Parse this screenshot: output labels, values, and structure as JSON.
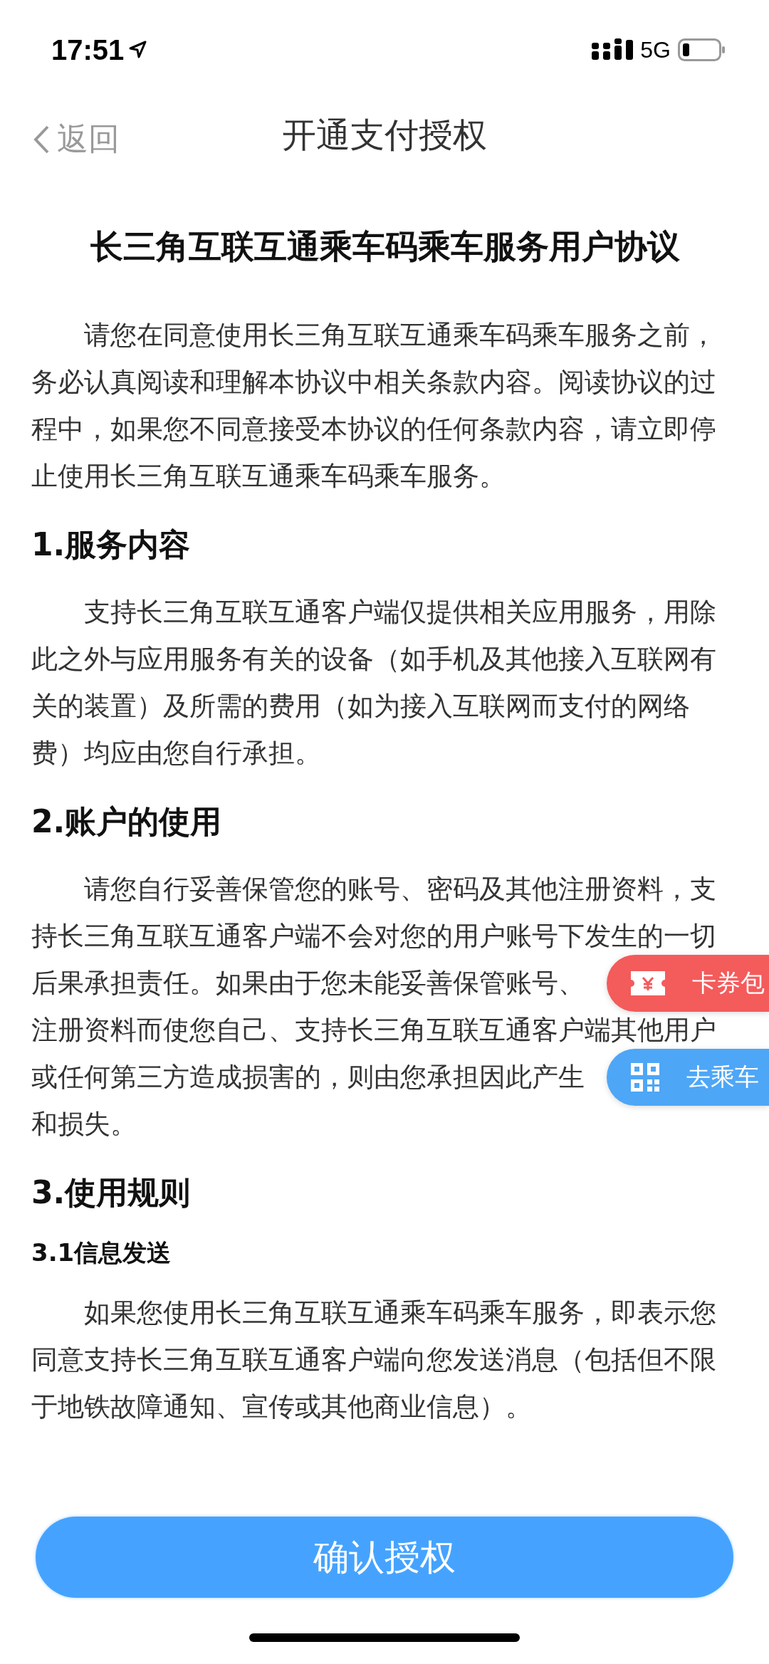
{
  "status_bar": {
    "time": "17:51",
    "network": "5G"
  },
  "nav": {
    "back": "返回",
    "title": "开通支付授权"
  },
  "document": {
    "title": "长三角互联互通乘车码乘车服务用户协议",
    "blocks": [
      {
        "kind": "paragraph",
        "lines": [
          "请您在同意使用长三角互联互通乘车码乘车服务之前，",
          "务必认真阅读和理解本协议中相关条款内容。阅读协议的过",
          "程中，如果您不同意接受本协议的任何条款内容，请立即停",
          "止使用长三角互联互通乘车码乘车服务。"
        ]
      },
      {
        "kind": "heading",
        "text": "1.服务内容"
      },
      {
        "kind": "paragraph",
        "lines": [
          "支持长三角互联互通客户端仅提供相关应用服务，用除",
          "此之外与应用服务有关的设备（如手机及其他接入互联网有",
          "关的装置）及所需的费用（如为接入互联网而支付的网络",
          "费）均应由您自行承担。"
        ]
      },
      {
        "kind": "heading",
        "text": "2.账户的使用"
      },
      {
        "kind": "paragraph",
        "lines": [
          "请您自行妥善保管您的账号、密码及其他注册资料，支",
          "持长三角互联互通客户端不会对您的用户账号下发生的一切",
          "后果承担责任。如果由于您未能妥善保管账号、",
          "注册资料而使您自己、支持长三角互联互通客户端其他用户",
          "或任何第三方造成损害的，则由您承担因此产生",
          "和损失。"
        ]
      },
      {
        "kind": "heading",
        "text": "3.使用规则"
      },
      {
        "kind": "subheading",
        "text": "3.1信息发送"
      },
      {
        "kind": "paragraph",
        "lines": [
          "如果您使用长三角互联互通乘车码乘车服务，即表示您",
          "同意支持长三角互联互通客户端向您发送消息（包括但不限",
          "于地铁故障通知、宣传或其他商业信息）。"
        ]
      }
    ]
  },
  "floating_buttons": [
    {
      "kind": "ticket",
      "label": "卡券包",
      "color": "#f45b5b"
    },
    {
      "kind": "qr",
      "label": "去乘车",
      "color": "#4ea6f7"
    }
  ],
  "confirm_button": {
    "label": "确认授权"
  }
}
